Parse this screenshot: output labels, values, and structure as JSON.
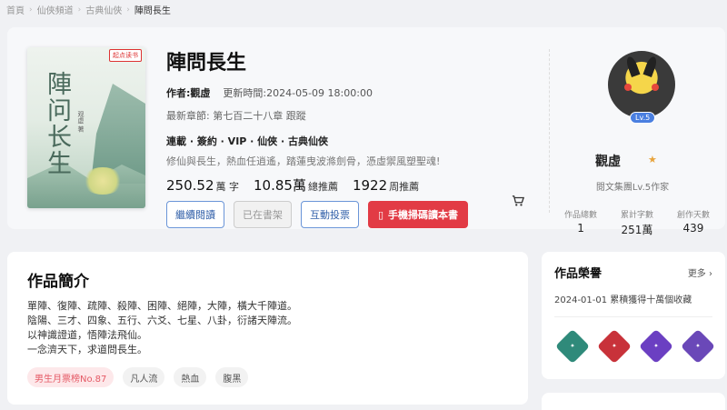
{
  "breadcrumb": {
    "items": [
      "首頁",
      "仙俠頻道",
      "古典仙俠"
    ],
    "current": "陣問長生"
  },
  "book": {
    "title": "陣問長生",
    "author_label": "作者:觀虛",
    "updated_label": "更新時間:2024-05-09 18:00:00",
    "latest_chapter": "最新章節: 第七百二十八章 跟蹤",
    "tags_line": "連載 · 簽約 · VIP · 仙俠 · 古典仙俠",
    "tagline": "修仙與長生，熱血任逍遙，踏蓮曳波滌劍骨，憑虛禦風塑聖魂!",
    "stats": [
      {
        "num": "250.52",
        "unit": "萬 字"
      },
      {
        "num": "10.85萬",
        "unit": "總推薦"
      },
      {
        "num": "1922",
        "unit": "周推薦"
      }
    ],
    "buttons": {
      "read": "繼續閱讀",
      "shelf": "已在書架",
      "vote": "互動投票",
      "phone": "手機掃碼讀本書"
    },
    "cover": {
      "title": "陣问长生",
      "brand": "起点读书",
      "author": "观虚 著"
    }
  },
  "author": {
    "name": "觀虛",
    "level": "Lv.5",
    "rank": "閱文集團Lv.5作家",
    "stats": [
      {
        "label": "作品總數",
        "value": "1"
      },
      {
        "label": "累計字數",
        "value": "251萬"
      },
      {
        "label": "創作天數",
        "value": "439"
      }
    ]
  },
  "intro": {
    "title": "作品簡介",
    "lines": [
      "單陣、復陣、疏陣、殺陣、困陣、絕陣，大陣，橫大千陣道。",
      "陰陽、三才、四象、五行、六爻、七星、八卦，衍諸天陣流。",
      "以神識證道，悟陣法飛仙。",
      "一念濟天下，求道問長生。"
    ],
    "chips": [
      "男生月票榜No.87",
      "凡人流",
      "熱血",
      "腹黑"
    ]
  },
  "honor": {
    "title": "作品榮譽",
    "more": "更多",
    "record": "2024-01-01 累積獲得十萬個收藏",
    "badge_colors": [
      "#2f8a7a",
      "#c8323a",
      "#6b3fc2",
      "#6a48b8"
    ]
  },
  "icons": {
    "cart": "cart-icon",
    "phone": "phone-icon",
    "chevron": "chevron-right-icon"
  }
}
